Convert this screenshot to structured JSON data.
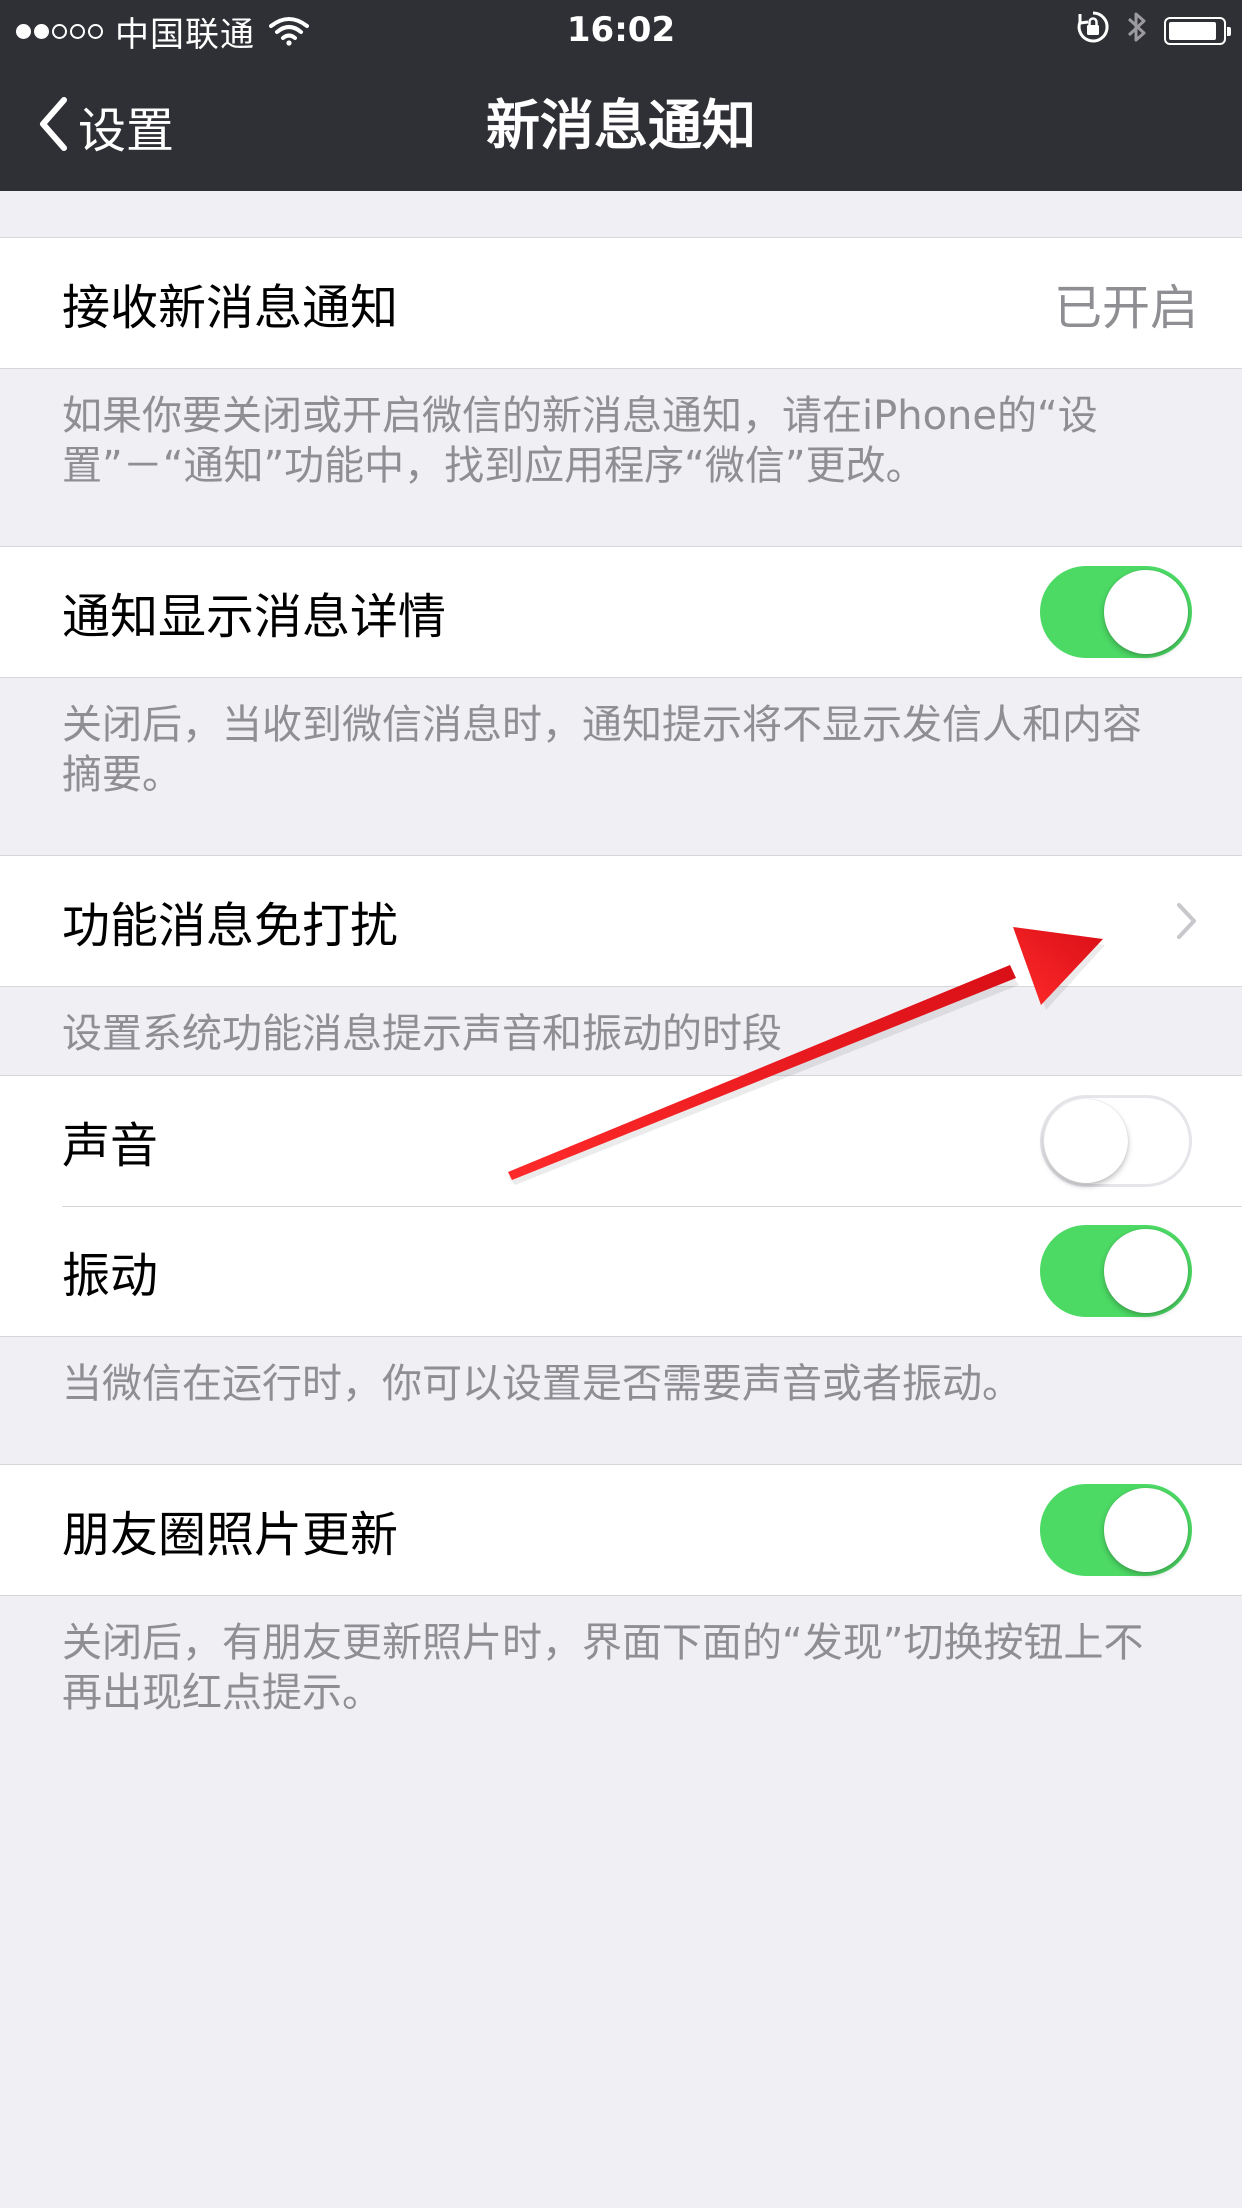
{
  "status_bar": {
    "signal_full": 2,
    "signal_total": 5,
    "carrier": "中国联通",
    "time": "16:02",
    "icons": [
      "wifi-icon",
      "rotation-lock-icon",
      "bluetooth-icon",
      "battery-icon"
    ],
    "battery_level": 0.9
  },
  "nav": {
    "back_label": "设置",
    "back_icon": "chevron-left-icon",
    "title": "新消息通知"
  },
  "sections": {
    "receive": {
      "title": "接收新消息通知",
      "value": "已开启",
      "footer": "如果你要关闭或开启微信的新消息通知，请在iPhone的“设置”－“通知”功能中，找到应用程序“微信”更改。"
    },
    "details": {
      "title": "通知显示消息详情",
      "enabled": true,
      "footer": "关闭后，当收到微信消息时，通知提示将不显示发信人和内容摘要。"
    },
    "dnd": {
      "title": "功能消息免打扰",
      "icon": "chevron-right-icon",
      "footer": "设置系统功能消息提示声音和振动的时段"
    },
    "sound": {
      "title": "声音",
      "enabled": false
    },
    "vibrate": {
      "title": "振动",
      "enabled": true,
      "footer": "当微信在运行时，你可以设置是否需要声音或者振动。"
    },
    "moments": {
      "title": "朋友圈照片更新",
      "enabled": true,
      "footer": "关闭后，有朋友更新照片时，界面下面的“发现”切换按钮上不再出现红点提示。"
    }
  },
  "colors": {
    "nav_background": "#2f3035",
    "page_background": "#efeff4",
    "toggle_on": "#4cd964",
    "secondary_text": "#8e8e93",
    "annotation_arrow": "#e8141b"
  }
}
